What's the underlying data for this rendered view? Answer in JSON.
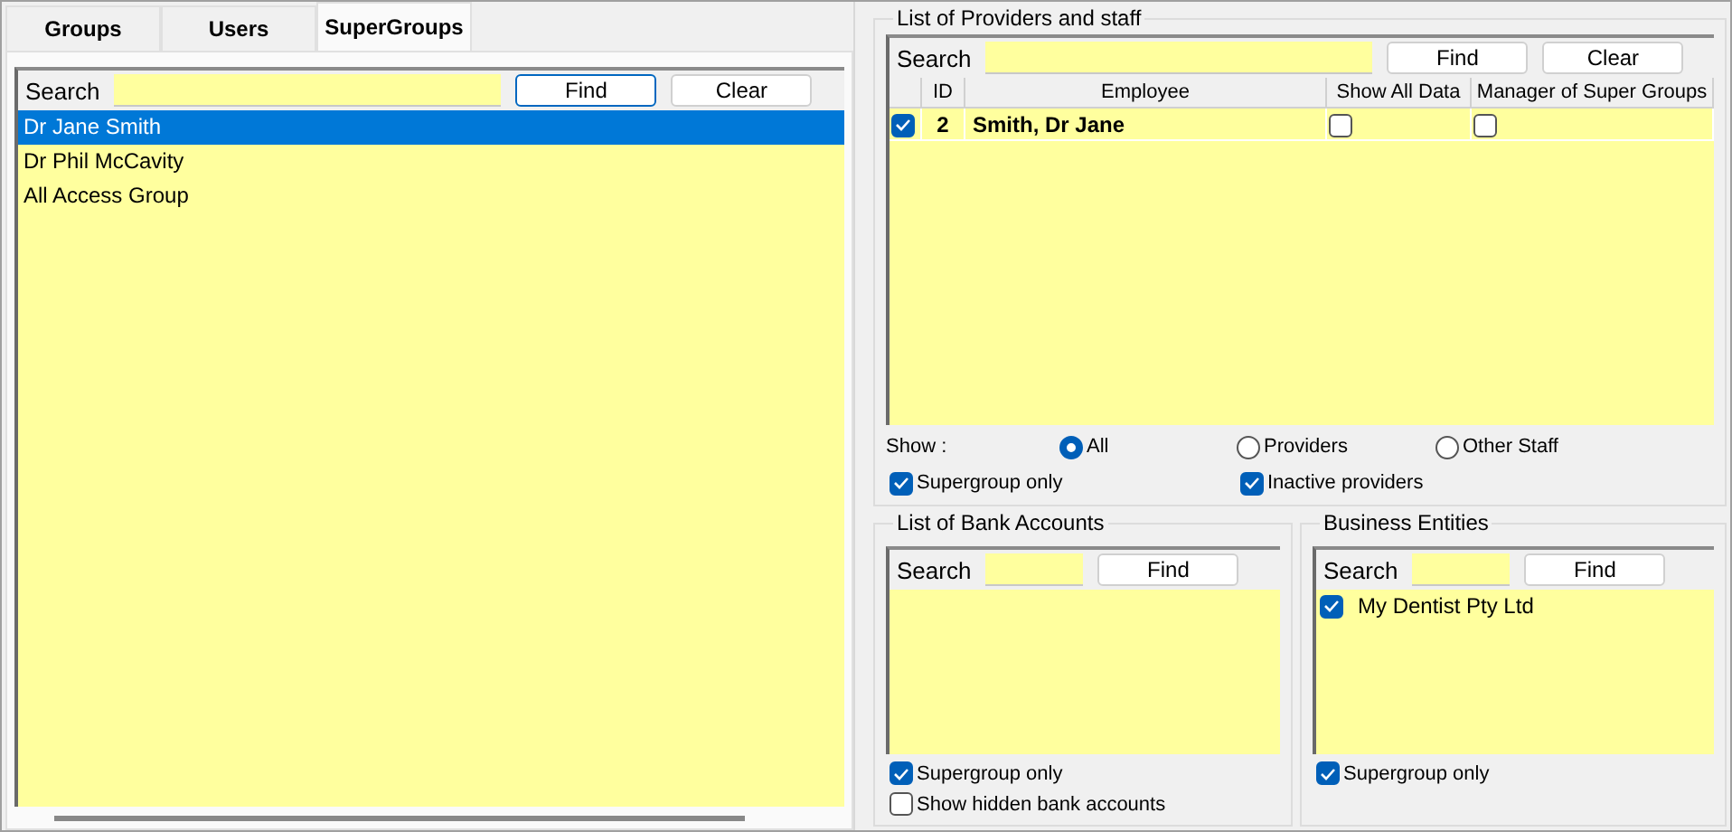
{
  "tabs": [
    {
      "label": "Groups",
      "selected": false
    },
    {
      "label": "Users",
      "selected": false
    },
    {
      "label": "SuperGroups",
      "selected": true
    }
  ],
  "supergroups": {
    "search_label": "Search",
    "find": "Find",
    "clear": "Clear",
    "items": [
      {
        "label": "Dr Jane Smith",
        "selected": true
      },
      {
        "label": "Dr Phil McCavity",
        "selected": false
      },
      {
        "label": "All Access Group",
        "selected": false
      }
    ]
  },
  "providers": {
    "title": "List of Providers and staff",
    "search_label": "Search",
    "find": "Find",
    "clear": "Clear",
    "columns": [
      "ID",
      "Employee",
      "Show All Data",
      "Manager of Super Groups"
    ],
    "rows": [
      {
        "checked": true,
        "id": "2",
        "employee": "Smith, Dr Jane",
        "show_all_data": false,
        "manager": false
      }
    ],
    "show_label": "Show :",
    "show_options": [
      {
        "label": "All",
        "selected": true
      },
      {
        "label": "Providers",
        "selected": false
      },
      {
        "label": "Other Staff",
        "selected": false
      }
    ],
    "supergroup_only": {
      "label": "Supergroup only",
      "checked": true
    },
    "inactive_providers": {
      "label": "Inactive providers",
      "checked": true
    }
  },
  "bank_accounts": {
    "title": "List of Bank Accounts",
    "search_label": "Search",
    "find": "Find",
    "options": [
      {
        "label": "Supergroup only",
        "checked": true
      },
      {
        "label": "Show hidden bank accounts",
        "checked": false
      }
    ]
  },
  "business_entities": {
    "title": "Business Entities",
    "search_label": "Search",
    "find": "Find",
    "items": [
      {
        "label": "My Dentist Pty Ltd",
        "checked": true
      }
    ],
    "options": [
      {
        "label": "Supergroup only",
        "checked": true
      }
    ]
  }
}
